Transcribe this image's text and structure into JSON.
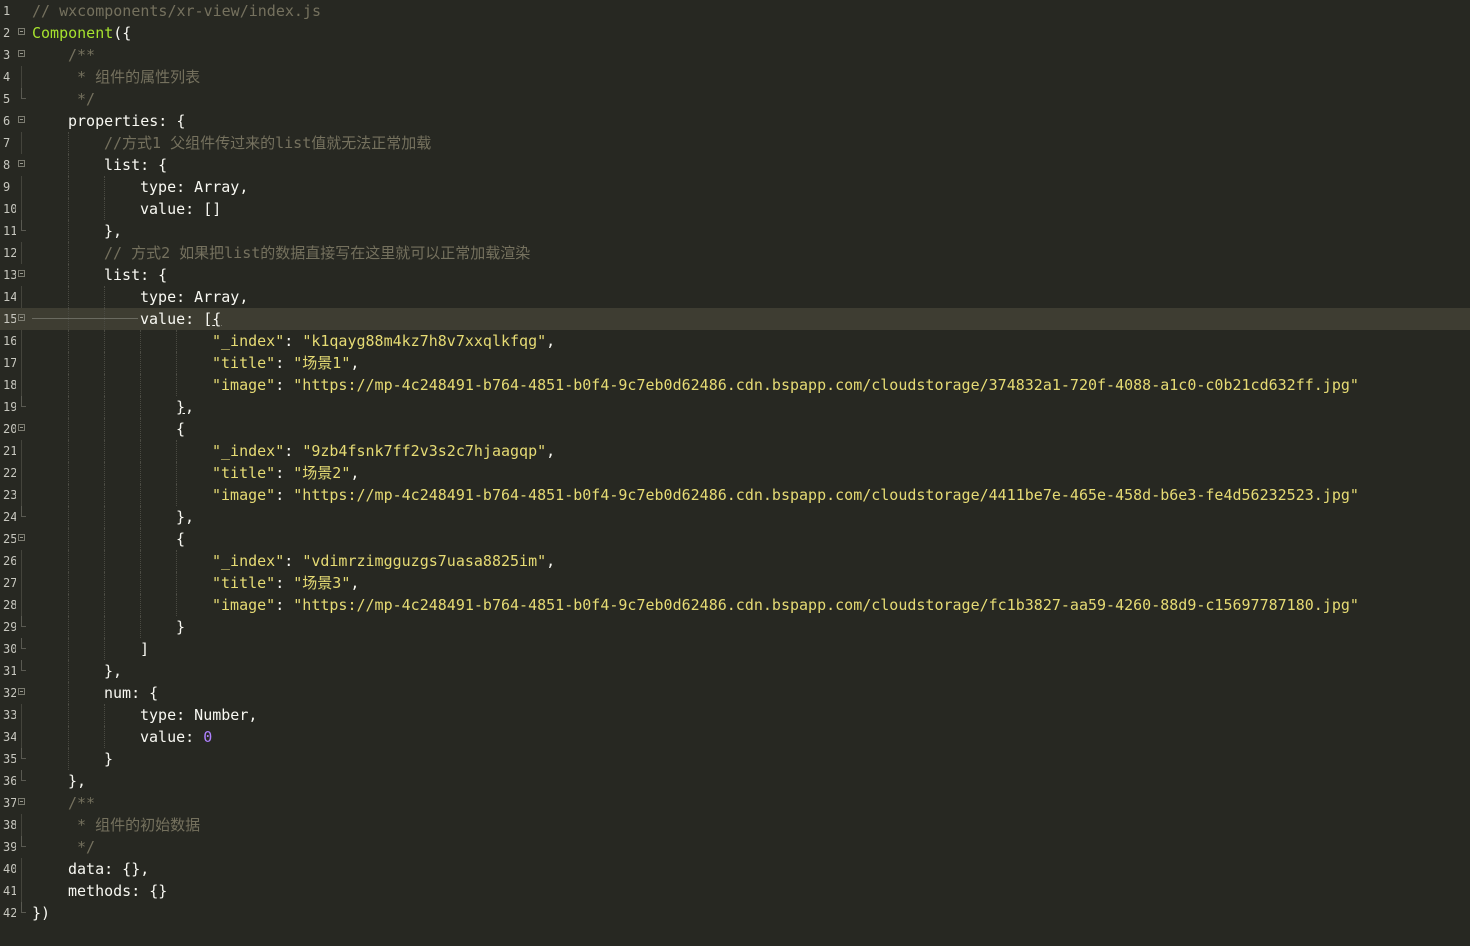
{
  "editor": {
    "lines": [
      {
        "n": "1",
        "indent": 0,
        "fold": "none",
        "tokens": [
          {
            "c": "cm",
            "t": "// wxcomponents/xr-view/index.js"
          }
        ]
      },
      {
        "n": "2",
        "indent": 0,
        "fold": "open",
        "tokens": [
          {
            "c": "fn",
            "t": "Component"
          },
          {
            "c": "pl",
            "t": "({"
          }
        ]
      },
      {
        "n": "3",
        "indent": 1,
        "fold": "open",
        "tokens": [
          {
            "c": "cm",
            "t": "/**"
          }
        ]
      },
      {
        "n": "4",
        "indent": 1,
        "fold": "mid",
        "tokens": [
          {
            "c": "cm",
            "t": " * 组件的属性列表"
          }
        ]
      },
      {
        "n": "5",
        "indent": 1,
        "fold": "end",
        "tokens": [
          {
            "c": "cm",
            "t": " */"
          }
        ]
      },
      {
        "n": "6",
        "indent": 1,
        "fold": "open",
        "tokens": [
          {
            "c": "pl",
            "t": "properties: {"
          }
        ]
      },
      {
        "n": "7",
        "indent": 2,
        "fold": "mid",
        "tokens": [
          {
            "c": "cm",
            "t": "//方式1 父组件传过来的list值就无法正常加载"
          }
        ]
      },
      {
        "n": "8",
        "indent": 2,
        "fold": "open",
        "tokens": [
          {
            "c": "pl",
            "t": "list: {"
          }
        ]
      },
      {
        "n": "9",
        "indent": 3,
        "fold": "mid",
        "tokens": [
          {
            "c": "pl",
            "t": "type: Array,"
          }
        ]
      },
      {
        "n": "10",
        "indent": 3,
        "fold": "mid",
        "tokens": [
          {
            "c": "pl",
            "t": "value: []"
          }
        ]
      },
      {
        "n": "11",
        "indent": 2,
        "fold": "end",
        "tokens": [
          {
            "c": "pl",
            "t": "},"
          }
        ]
      },
      {
        "n": "12",
        "indent": 2,
        "fold": "mid",
        "tokens": [
          {
            "c": "cm",
            "t": "// 方式2 如果把list的数据直接写在这里就可以正常加载渲染"
          }
        ]
      },
      {
        "n": "13",
        "indent": 2,
        "fold": "open",
        "tokens": [
          {
            "c": "pl",
            "t": "list: {"
          }
        ]
      },
      {
        "n": "14",
        "indent": 3,
        "fold": "mid",
        "tokens": [
          {
            "c": "pl",
            "t": "type: Array,"
          }
        ]
      },
      {
        "n": "15",
        "indent": 3,
        "fold": "open",
        "active": true,
        "tokens": [
          {
            "c": "pl",
            "t": "value: ["
          },
          {
            "c": "pl hl",
            "t": "{"
          }
        ]
      },
      {
        "n": "16",
        "indent": 5,
        "fold": "mid",
        "tokens": [
          {
            "c": "st",
            "t": "\"_index\""
          },
          {
            "c": "pl",
            "t": ": "
          },
          {
            "c": "st",
            "t": "\"k1qayg88m4kz7h8v7xxqlkfqg\""
          },
          {
            "c": "pl",
            "t": ","
          }
        ]
      },
      {
        "n": "17",
        "indent": 5,
        "fold": "mid",
        "tokens": [
          {
            "c": "st",
            "t": "\"title\""
          },
          {
            "c": "pl",
            "t": ": "
          },
          {
            "c": "st",
            "t": "\"场景1\""
          },
          {
            "c": "pl",
            "t": ","
          }
        ]
      },
      {
        "n": "18",
        "indent": 5,
        "fold": "mid",
        "tokens": [
          {
            "c": "st",
            "t": "\"image\""
          },
          {
            "c": "pl",
            "t": ": "
          },
          {
            "c": "st",
            "t": "\"https://mp-4c248491-b764-4851-b0f4-9c7eb0d62486.cdn.bspapp.com/cloudstorage/374832a1-720f-4088-a1c0-c0b21cd632ff.jpg\""
          }
        ]
      },
      {
        "n": "19",
        "indent": 4,
        "fold": "end",
        "tokens": [
          {
            "c": "pl hl",
            "t": "}"
          },
          {
            "c": "pl",
            "t": ","
          }
        ]
      },
      {
        "n": "20",
        "indent": 4,
        "fold": "open",
        "tokens": [
          {
            "c": "pl",
            "t": "{"
          }
        ]
      },
      {
        "n": "21",
        "indent": 5,
        "fold": "mid",
        "tokens": [
          {
            "c": "st",
            "t": "\"_index\""
          },
          {
            "c": "pl",
            "t": ": "
          },
          {
            "c": "st",
            "t": "\"9zb4fsnk7ff2v3s2c7hjaagqp\""
          },
          {
            "c": "pl",
            "t": ","
          }
        ]
      },
      {
        "n": "22",
        "indent": 5,
        "fold": "mid",
        "tokens": [
          {
            "c": "st",
            "t": "\"title\""
          },
          {
            "c": "pl",
            "t": ": "
          },
          {
            "c": "st",
            "t": "\"场景2\""
          },
          {
            "c": "pl",
            "t": ","
          }
        ]
      },
      {
        "n": "23",
        "indent": 5,
        "fold": "mid",
        "tokens": [
          {
            "c": "st",
            "t": "\"image\""
          },
          {
            "c": "pl",
            "t": ": "
          },
          {
            "c": "st",
            "t": "\"https://mp-4c248491-b764-4851-b0f4-9c7eb0d62486.cdn.bspapp.com/cloudstorage/4411be7e-465e-458d-b6e3-fe4d56232523.jpg\""
          }
        ]
      },
      {
        "n": "24",
        "indent": 4,
        "fold": "end",
        "tokens": [
          {
            "c": "pl",
            "t": "},"
          }
        ]
      },
      {
        "n": "25",
        "indent": 4,
        "fold": "open",
        "tokens": [
          {
            "c": "pl",
            "t": "{"
          }
        ]
      },
      {
        "n": "26",
        "indent": 5,
        "fold": "mid",
        "tokens": [
          {
            "c": "st",
            "t": "\"_index\""
          },
          {
            "c": "pl",
            "t": ": "
          },
          {
            "c": "st",
            "t": "\"vdimrzimgguzgs7uasa8825im\""
          },
          {
            "c": "pl",
            "t": ","
          }
        ]
      },
      {
        "n": "27",
        "indent": 5,
        "fold": "mid",
        "tokens": [
          {
            "c": "st",
            "t": "\"title\""
          },
          {
            "c": "pl",
            "t": ": "
          },
          {
            "c": "st",
            "t": "\"场景3\""
          },
          {
            "c": "pl",
            "t": ","
          }
        ]
      },
      {
        "n": "28",
        "indent": 5,
        "fold": "mid",
        "tokens": [
          {
            "c": "st",
            "t": "\"image\""
          },
          {
            "c": "pl",
            "t": ": "
          },
          {
            "c": "st",
            "t": "\"https://mp-4c248491-b764-4851-b0f4-9c7eb0d62486.cdn.bspapp.com/cloudstorage/fc1b3827-aa59-4260-88d9-c15697787180.jpg\""
          }
        ]
      },
      {
        "n": "29",
        "indent": 4,
        "fold": "end",
        "tokens": [
          {
            "c": "pl",
            "t": "}"
          }
        ]
      },
      {
        "n": "30",
        "indent": 3,
        "fold": "end",
        "tokens": [
          {
            "c": "pl",
            "t": "]"
          }
        ]
      },
      {
        "n": "31",
        "indent": 2,
        "fold": "end",
        "tokens": [
          {
            "c": "pl",
            "t": "},"
          }
        ]
      },
      {
        "n": "32",
        "indent": 2,
        "fold": "open",
        "tokens": [
          {
            "c": "pl",
            "t": "num: {"
          }
        ]
      },
      {
        "n": "33",
        "indent": 3,
        "fold": "mid",
        "tokens": [
          {
            "c": "pl",
            "t": "type: Number,"
          }
        ]
      },
      {
        "n": "34",
        "indent": 3,
        "fold": "mid",
        "tokens": [
          {
            "c": "pl",
            "t": "value: "
          },
          {
            "c": "nm",
            "t": "0"
          }
        ]
      },
      {
        "n": "35",
        "indent": 2,
        "fold": "end",
        "tokens": [
          {
            "c": "pl",
            "t": "}"
          }
        ]
      },
      {
        "n": "36",
        "indent": 1,
        "fold": "end",
        "tokens": [
          {
            "c": "pl",
            "t": "},"
          }
        ]
      },
      {
        "n": "37",
        "indent": 1,
        "fold": "open",
        "tokens": [
          {
            "c": "cm",
            "t": "/**"
          }
        ]
      },
      {
        "n": "38",
        "indent": 1,
        "fold": "mid",
        "tokens": [
          {
            "c": "cm",
            "t": " * 组件的初始数据"
          }
        ]
      },
      {
        "n": "39",
        "indent": 1,
        "fold": "end",
        "tokens": [
          {
            "c": "cm",
            "t": " */"
          }
        ]
      },
      {
        "n": "40",
        "indent": 1,
        "fold": "mid",
        "tokens": [
          {
            "c": "pl",
            "t": "data: {},"
          }
        ]
      },
      {
        "n": "41",
        "indent": 1,
        "fold": "mid",
        "tokens": [
          {
            "c": "pl",
            "t": "methods: {}"
          }
        ]
      },
      {
        "n": "42",
        "indent": 0,
        "fold": "end",
        "tokens": [
          {
            "c": "pl",
            "t": "})"
          }
        ]
      }
    ]
  },
  "colors": {
    "background": "#272822",
    "active_line": "#3e3d32",
    "comment": "#75715e",
    "function": "#a6e22e",
    "string": "#e6db74",
    "number": "#ae81ff",
    "plain": "#f8f8f2"
  }
}
